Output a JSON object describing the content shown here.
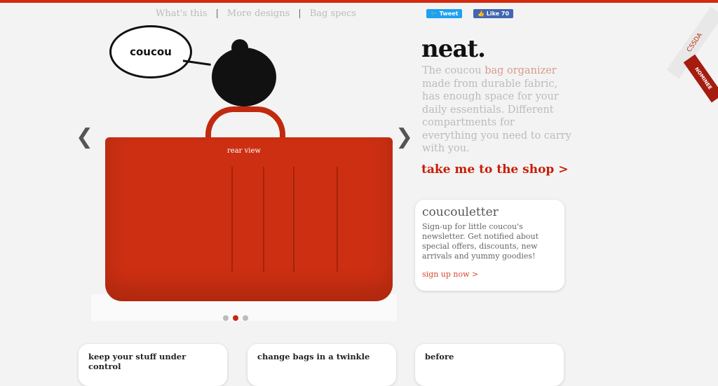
{
  "nav": {
    "items": [
      "What's this",
      "More designs",
      "Bag specs"
    ]
  },
  "social": {
    "tweet": "Tweet",
    "like": "Like 70"
  },
  "slideshow": {
    "bubble": "coucou",
    "caption": "rear view",
    "active_slide": 2,
    "total_slides": 3,
    "bag_color": "#cc2f12"
  },
  "hero": {
    "title": "neat.",
    "desc_pre": "The coucou ",
    "desc_link": "bag organizer",
    "desc_post": " made from durable fabric, has enough space for your daily essentials. Different compartments for everything you need to carry with you.",
    "cta": "take me to the shop >"
  },
  "newsletter": {
    "title": "coucouletter",
    "body": "Sign-up for little coucou's newsletter. Get notified about special offers, discounts, new arrivals and yummy goodies!",
    "link": "sign up now >"
  },
  "features": [
    "keep your stuff under control",
    "change bags in a twinkle",
    "before"
  ],
  "badge": {
    "label": "CSSDA",
    "ribbon": "NOMINEE"
  },
  "colors": {
    "accent": "#d42a0e"
  }
}
